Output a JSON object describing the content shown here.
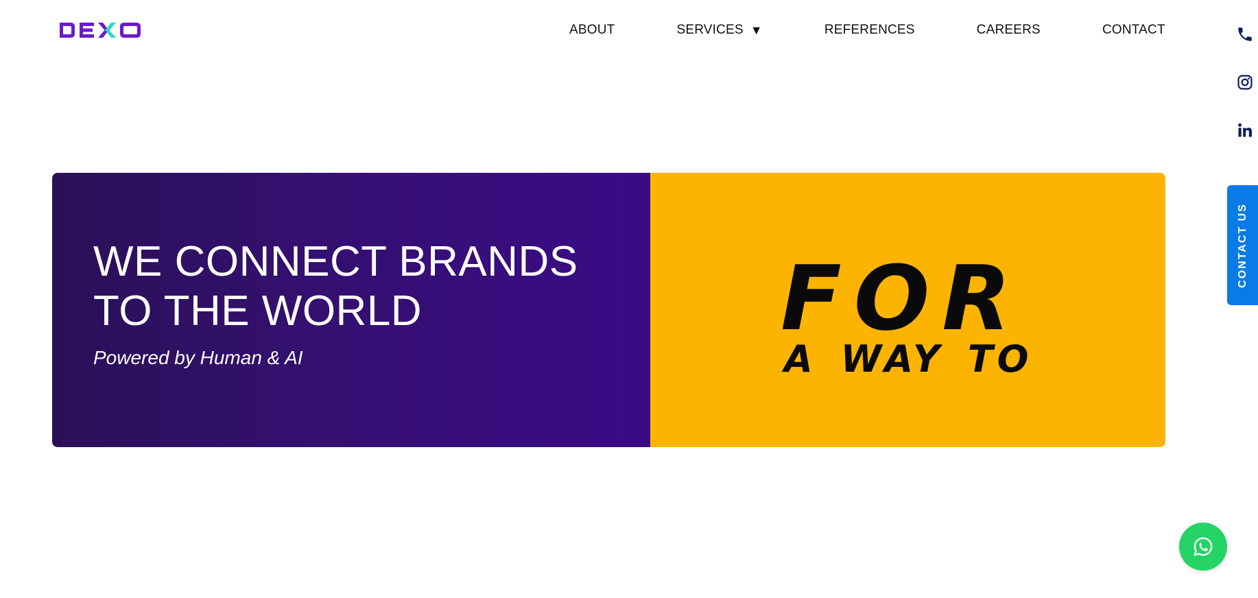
{
  "header": {
    "logo_text": "DEXO",
    "nav": {
      "about": "ABOUT",
      "services": "SERVICES",
      "services_caret": "▼",
      "references": "REFERENCES",
      "careers": "CAREERS",
      "contact": "CONTACT"
    }
  },
  "social": {
    "icons": [
      "phone-icon",
      "instagram-icon",
      "linkedin-icon"
    ]
  },
  "sidebar_tab": {
    "label": "CONTACT US"
  },
  "hero": {
    "headline_line1": "WE CONNECT BRANDS",
    "headline_line2": "TO THE WORLD",
    "tagline": "Powered by Human & AI",
    "animated_big": "FOR",
    "animated_small": "A WAY TO"
  },
  "colors": {
    "brand_purple": "#6a1bc9",
    "brand_cyan": "#2fd3c7",
    "banner_gradient_start": "#2b1057",
    "banner_gradient_end": "#3b0b87",
    "banner_yellow": "#fdb400",
    "contact_tab_blue": "#0a7be6",
    "whatsapp_green": "#25d366",
    "social_icon_navy": "#0d1d5b"
  },
  "floating": {
    "icon": "whatsapp-icon"
  }
}
